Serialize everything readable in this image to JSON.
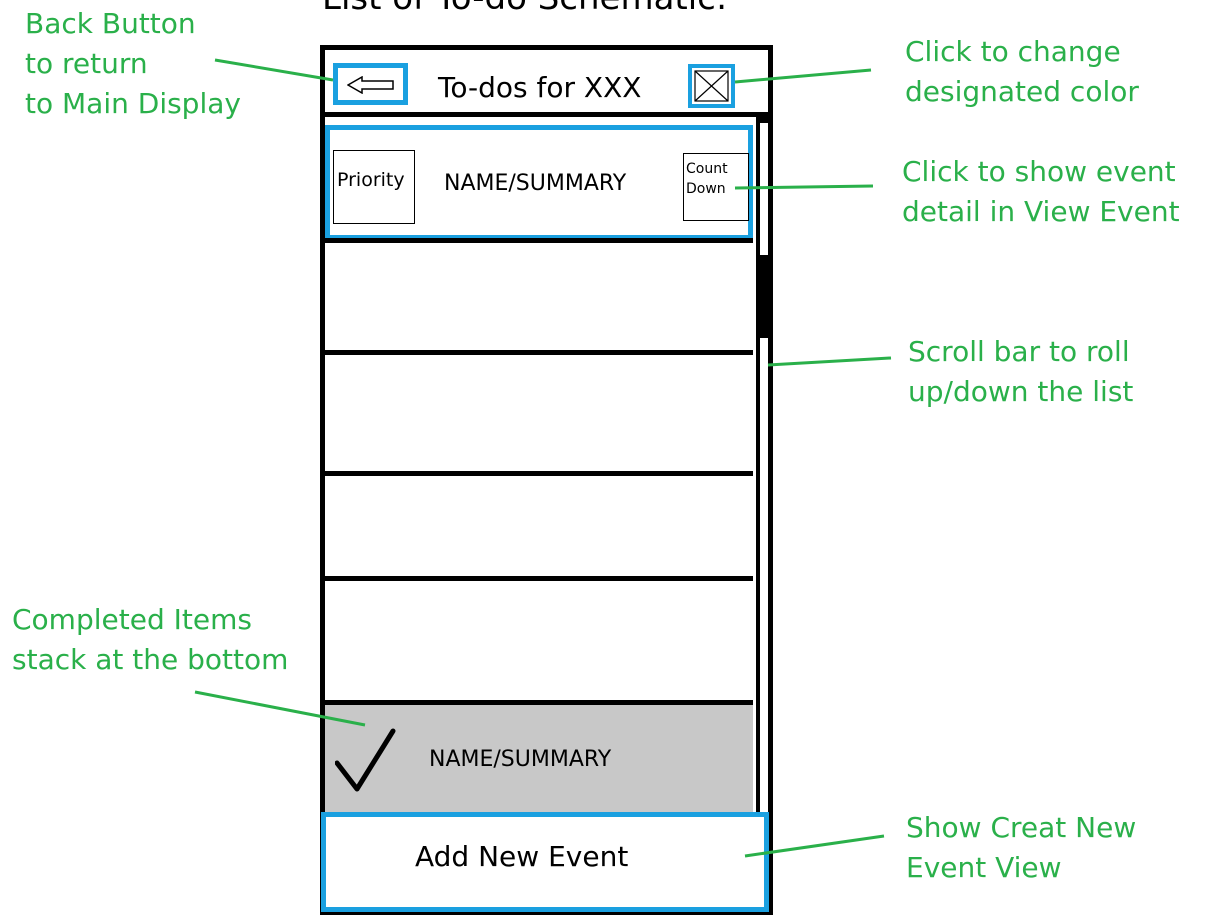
{
  "title": "List of To-do Schematic:",
  "header": {
    "title": "To-dos for XXX",
    "back_icon": "left-arrow-icon",
    "color_icon": "crossed-box-icon"
  },
  "list": {
    "first_item": {
      "priority": "Priority",
      "summary": "NAME/SUMMARY",
      "countdown_line1": "Count",
      "countdown_line2": "Down"
    },
    "completed_item": {
      "summary": "NAME/SUMMARY",
      "icon": "checkmark-icon"
    }
  },
  "add_button": {
    "label": "Add New Event"
  },
  "annotations": {
    "back": [
      "Back Button",
      "to return",
      "to Main Display"
    ],
    "color": [
      "Click to change",
      "designated color"
    ],
    "detail": [
      "Click to show event",
      "detail in View Event"
    ],
    "scroll": [
      "Scroll bar to roll",
      "up/down the list"
    ],
    "completed": [
      "Completed Items",
      "stack at the bottom"
    ],
    "create": [
      "Show Creat New",
      "Event View"
    ]
  },
  "colors": {
    "annotation": "#2ab04a",
    "highlight": "#1aa0e0",
    "completed_bg": "#c8c8c8"
  }
}
